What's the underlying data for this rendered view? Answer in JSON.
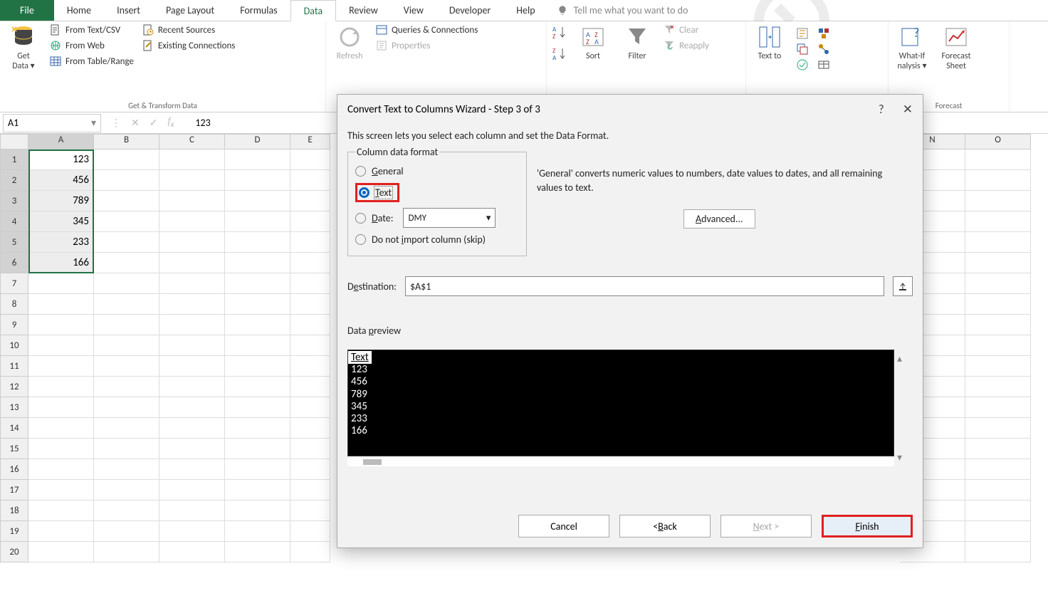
{
  "tabs": {
    "file": "File",
    "home": "Home",
    "insert": "Insert",
    "page_layout": "Page Layout",
    "formulas": "Formulas",
    "data": "Data",
    "review": "Review",
    "view": "View",
    "developer": "Developer",
    "help": "Help",
    "tell_me": "Tell me what you want to do"
  },
  "ribbon": {
    "get_data": "Get\nData",
    "from_text": "From Text/CSV",
    "from_web": "From Web",
    "from_table": "From Table/Range",
    "recent_sources": "Recent Sources",
    "existing_conn": "Existing Connections",
    "group1": "Get & Transform Data",
    "refresh": "Refresh",
    "queries": "Queries & Connections",
    "properties": "Properties",
    "sort": "Sort",
    "filter": "Filter",
    "clear": "Clear",
    "reapply": "Reapply",
    "text_to": "Text to",
    "whatif": "What-If\nAnalysis",
    "whatif_suffix": "nalysis",
    "forecast_sheet": "Forecast\nSheet",
    "forecast_group": "Forecast"
  },
  "formula_bar": {
    "name": "A1",
    "value": "123"
  },
  "grid": {
    "cols": [
      "A",
      "B",
      "C",
      "D",
      "E",
      "N",
      "O"
    ],
    "rows": [
      "1",
      "2",
      "3",
      "4",
      "5",
      "6",
      "7",
      "8",
      "9",
      "10",
      "11",
      "12",
      "13",
      "14",
      "15",
      "16",
      "17",
      "18",
      "19",
      "20"
    ],
    "data": {
      "1": "123",
      "2": "456",
      "3": "789",
      "4": "345",
      "5": "233",
      "6": "166"
    }
  },
  "dialog": {
    "title": "Convert Text to Columns Wizard - Step 3 of 3",
    "help": "?",
    "close": "✕",
    "intro": "This screen lets you select each column and set the Data Format.",
    "legend": "Column data format",
    "opt_general": "General",
    "opt_text": "Text",
    "opt_date": "Date:",
    "date_val": "DMY",
    "opt_skip": "Do not import column (skip)",
    "info": "'General' converts numeric values to numbers, date values to dates, and all remaining values to text.",
    "advanced": "Advanced...",
    "dest_label": "Destination:",
    "dest_val": "$A$1",
    "preview_label": "Data preview",
    "preview_head": "Text",
    "preview_lines": [
      "123",
      "456",
      "789",
      "345",
      "233",
      "166"
    ],
    "btn_cancel": "Cancel",
    "btn_back": "< Back",
    "btn_next": "Next >",
    "btn_finish": "Finish"
  }
}
